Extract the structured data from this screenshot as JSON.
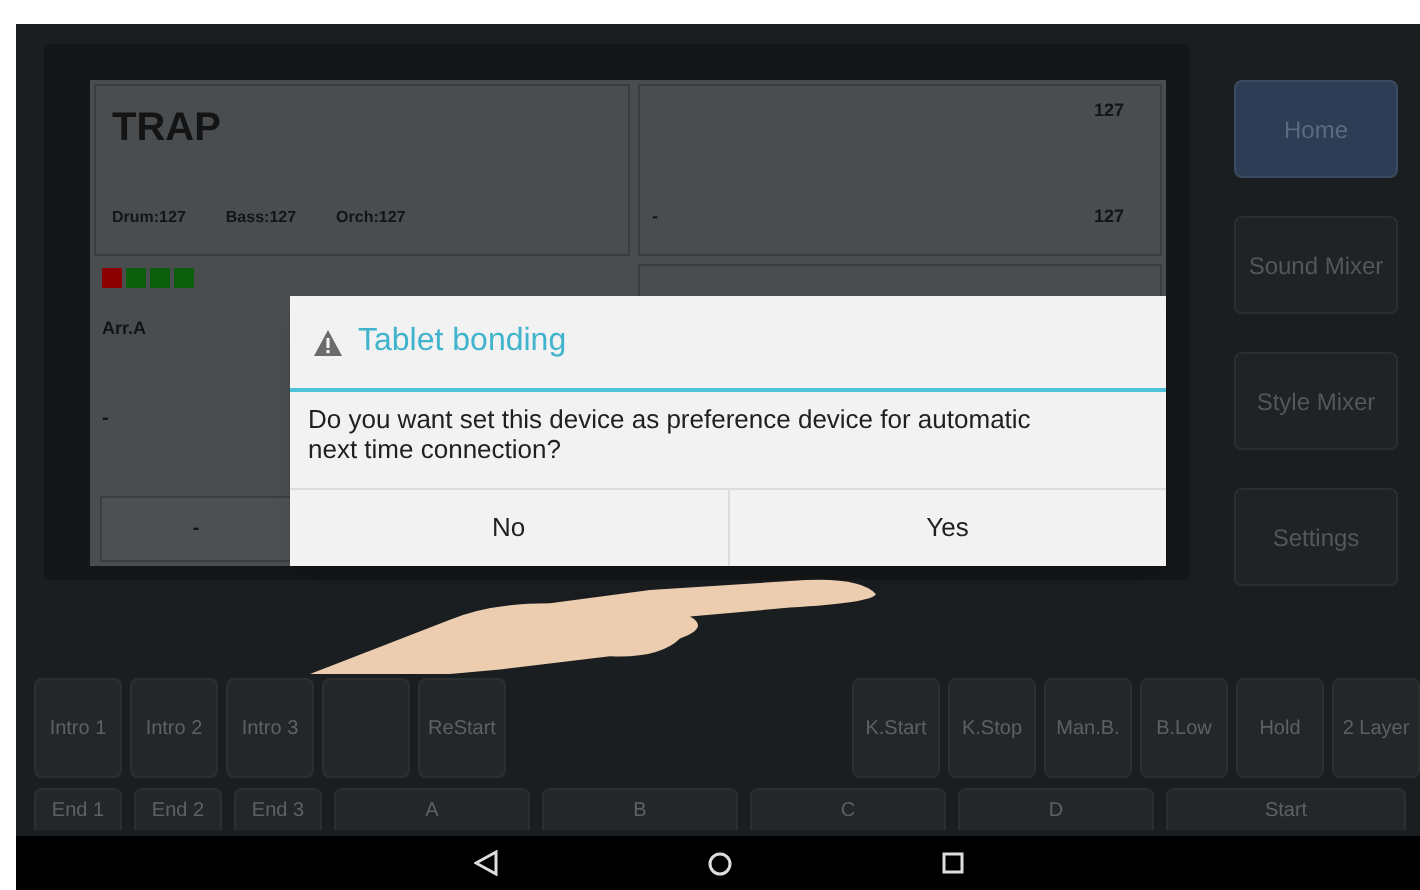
{
  "display": {
    "style_name": "TRAP",
    "parts": [
      {
        "label": "Drum:127"
      },
      {
        "label": "Bass:127"
      },
      {
        "label": "Orch:127"
      }
    ],
    "right_top": {
      "value_1": "127",
      "label": "-",
      "value_2": "127"
    },
    "meters": [
      {
        "color": "#8b0000"
      },
      {
        "color": "#0b5e0b"
      },
      {
        "color": "#0b5e0b"
      },
      {
        "color": "#0b5e0b"
      }
    ],
    "arrangement": "Arr.A",
    "line": "-",
    "button": "-"
  },
  "side_buttons": [
    {
      "label": "Home",
      "selected": true
    },
    {
      "label": "Sound Mixer",
      "selected": false
    },
    {
      "label": "Style Mixer",
      "selected": false
    },
    {
      "label": "Settings",
      "selected": false
    }
  ],
  "dialog": {
    "title": "Tablet bonding",
    "message": "Do you want set this device as preference device for automatic next time connection?",
    "buttons": [
      "No",
      "Yes"
    ]
  },
  "pad_row_1_left": [
    {
      "kind": "key",
      "label": "Intro 1"
    },
    {
      "kind": "key",
      "label": "Intro 2"
    },
    {
      "kind": "key",
      "label": "Intro 3"
    },
    {
      "kind": "blank"
    },
    {
      "kind": "key",
      "label": "ReStart"
    }
  ],
  "pad_row_1_right": [
    "K.Start",
    "K.Stop",
    "Man.B.",
    "B.Low",
    "Hold",
    "2 Layer"
  ],
  "pad_row_2": [
    {
      "label": "End 1",
      "kind": "small"
    },
    {
      "label": "End 2",
      "kind": "small"
    },
    {
      "label": "End 3",
      "kind": "small"
    },
    {
      "label": "A",
      "kind": "wide"
    },
    {
      "label": "B",
      "kind": "wide"
    },
    {
      "label": "C",
      "kind": "wide"
    },
    {
      "label": "D",
      "kind": "wide"
    },
    {
      "label": "Start",
      "kind": "large"
    }
  ]
}
